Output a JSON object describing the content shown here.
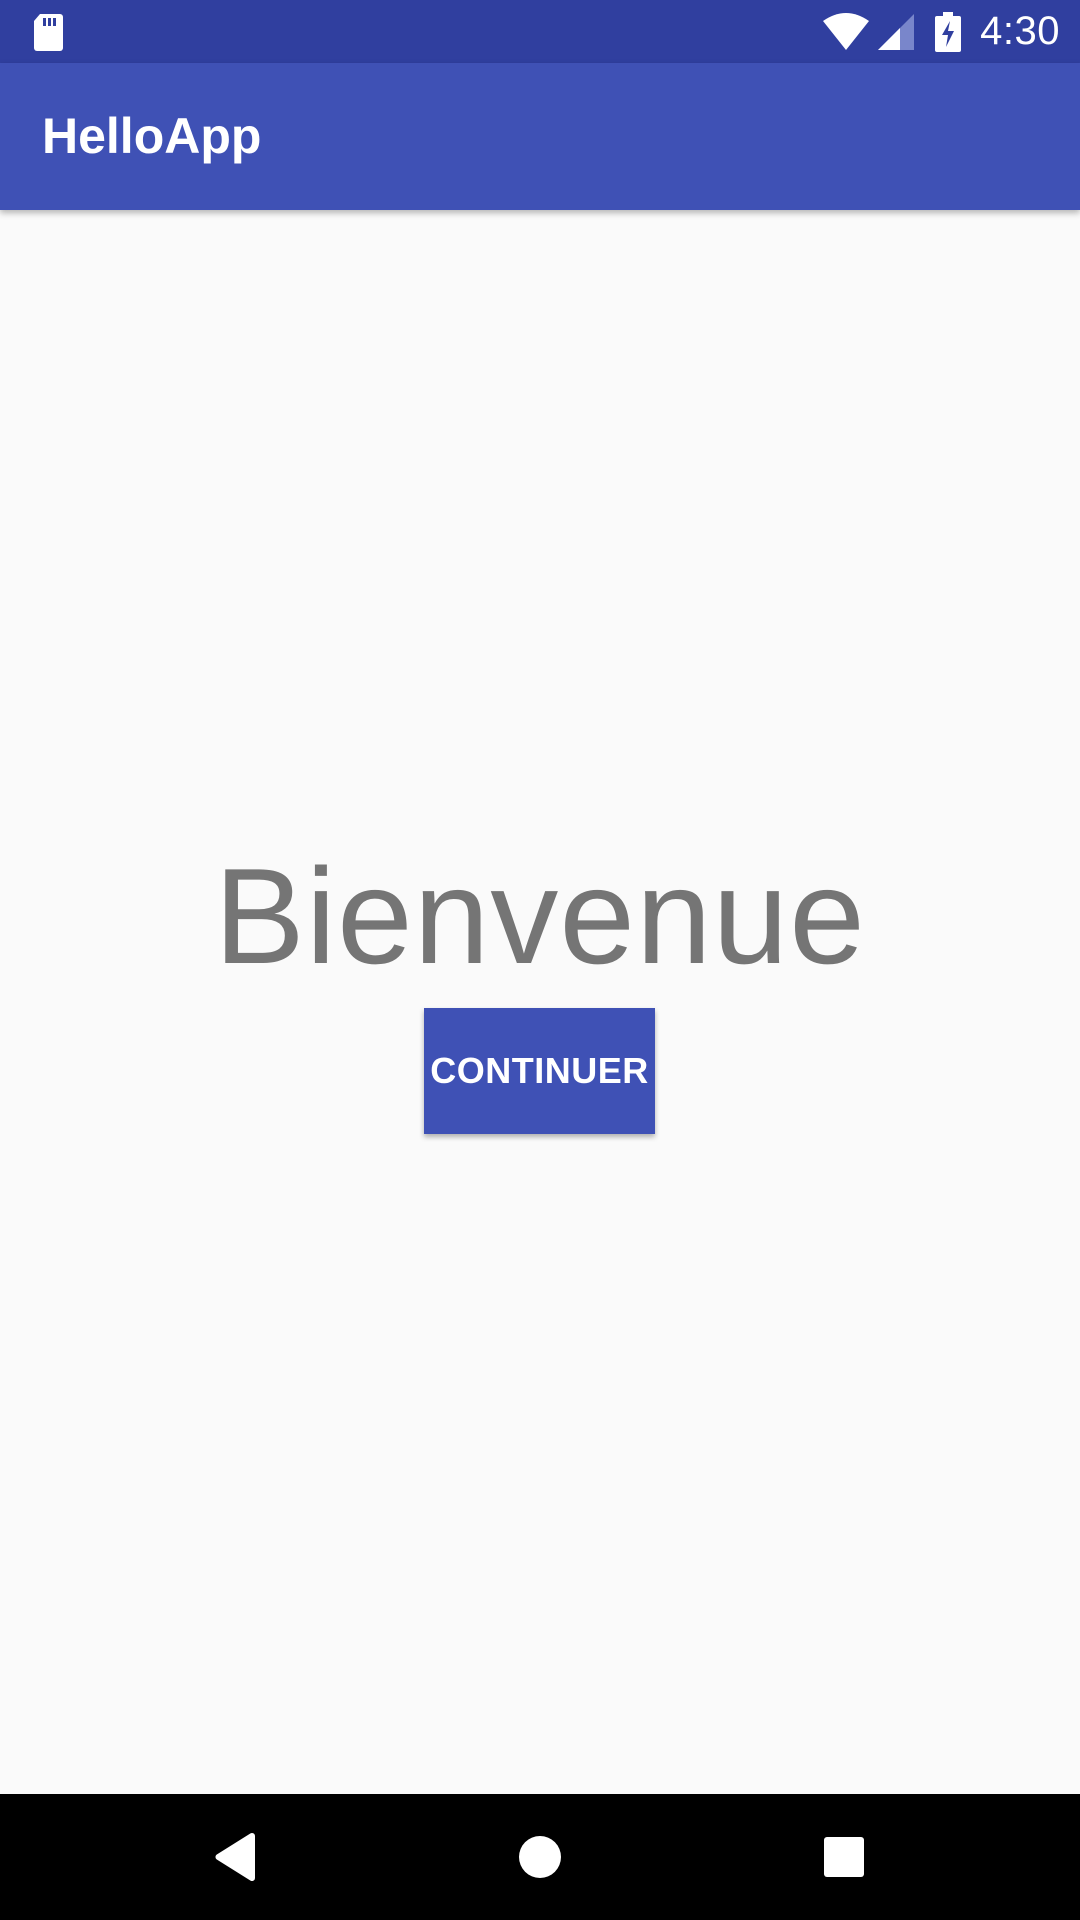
{
  "status_bar": {
    "time": "4:30",
    "icons": [
      "sd-card-icon",
      "wifi-icon",
      "signal-icon",
      "battery-charging-icon"
    ]
  },
  "app_bar": {
    "title": "HelloApp"
  },
  "main": {
    "welcome_text": "Bienvenue",
    "continue_label": "CONTINUER"
  },
  "nav_bar": {
    "icons": [
      "back-icon",
      "home-icon",
      "recents-icon"
    ]
  },
  "colors": {
    "status_bar": "#303f9f",
    "primary": "#3f51b5",
    "background": "#fafafa",
    "welcome_text": "#757575",
    "nav_bar": "#000000"
  }
}
